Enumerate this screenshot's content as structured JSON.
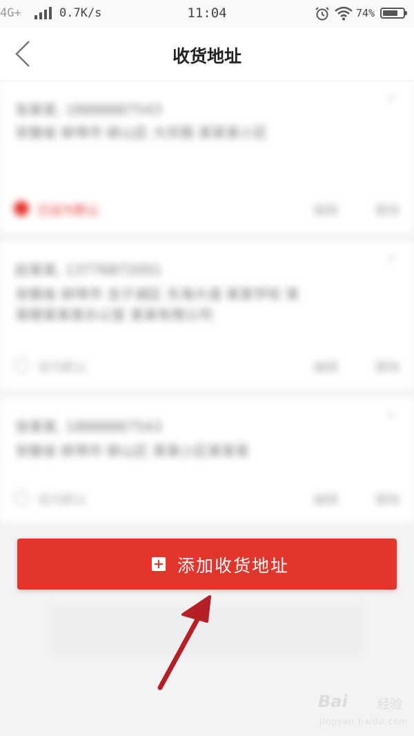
{
  "status_bar": {
    "network": "4G+",
    "speed": "0.7K/s",
    "time": "11:04",
    "battery_percent": "74%",
    "battery_level": 0.74,
    "icons": [
      "signal-icon",
      "alarm-icon",
      "wifi-icon",
      "battery-icon"
    ]
  },
  "nav": {
    "title": "收货地址",
    "back_icon": "chevron-left-icon"
  },
  "addresses": [
    {
      "name_phone": "张某某, 18888887543",
      "address": "安徽省 蚌埠市 蚌山区 大庆路 某某某小区",
      "is_default": true,
      "default_label": "已设为默认",
      "edit_label": "编辑",
      "delete_label": "删除"
    },
    {
      "name_phone": "赵某某, 13776872001",
      "address": "安徽省 蚌埠市 龙子湖区 东海大道 某某学校 某某楼某某某办公室 某某有限公司",
      "is_default": false,
      "default_label": "设为默认",
      "edit_label": "编辑",
      "delete_label": "删除"
    },
    {
      "name_phone": "张某某, 18888887543",
      "address": "安徽省 蚌埠市 蚌山区 某某小区某某某",
      "is_default": false,
      "default_label": "设为默认",
      "edit_label": "编辑",
      "delete_label": "删除"
    }
  ],
  "add_button": {
    "label": "添加收货地址",
    "icon": "plus-square-icon"
  },
  "colors": {
    "accent": "#e3352c",
    "annotation_arrow": "#b51f25",
    "background": "#f3f3f3"
  },
  "watermark": {
    "brand": "Bai",
    "suffix": "经验",
    "url": "jingyan.baidu.com"
  }
}
